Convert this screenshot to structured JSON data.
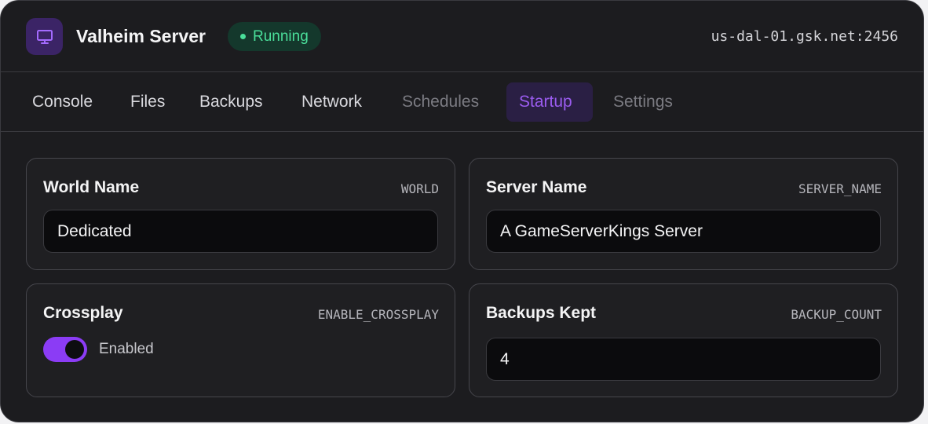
{
  "header": {
    "title": "Valheim Server",
    "status": "Running",
    "address": "us-dal-01.gsk.net:2456",
    "icon": "monitor-icon",
    "colors": {
      "accent": "#8b3cf5",
      "status": "#4ade9a"
    }
  },
  "tabs": [
    {
      "label": "Console",
      "state": "normal"
    },
    {
      "label": "Files",
      "state": "normal"
    },
    {
      "label": "Backups",
      "state": "normal"
    },
    {
      "label": "Network",
      "state": "normal"
    },
    {
      "label": "Schedules",
      "state": "disabled"
    },
    {
      "label": "Startup",
      "state": "active"
    },
    {
      "label": "Settings",
      "state": "disabled"
    }
  ],
  "variables": {
    "world_name": {
      "label": "World Name",
      "env": "WORLD",
      "value": "Dedicated"
    },
    "server_name": {
      "label": "Server Name",
      "env": "SERVER_NAME",
      "value": "A GameServerKings Server"
    },
    "crossplay": {
      "label": "Crossplay",
      "env": "ENABLE_CROSSPLAY",
      "enabled": true,
      "state_label": "Enabled"
    },
    "backups_kept": {
      "label": "Backups Kept",
      "env": "BACKUP_COUNT",
      "value": "4"
    }
  }
}
